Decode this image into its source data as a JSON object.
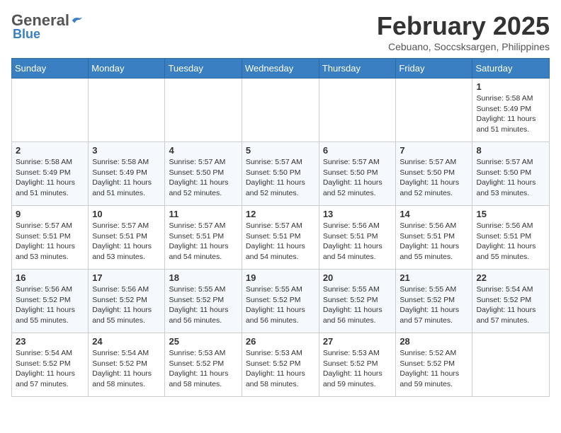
{
  "header": {
    "logo_general": "General",
    "logo_blue": "Blue",
    "month_title": "February 2025",
    "location": "Cebuano, Soccsksargen, Philippines"
  },
  "days_of_week": [
    "Sunday",
    "Monday",
    "Tuesday",
    "Wednesday",
    "Thursday",
    "Friday",
    "Saturday"
  ],
  "weeks": [
    [
      {
        "day": "",
        "info": ""
      },
      {
        "day": "",
        "info": ""
      },
      {
        "day": "",
        "info": ""
      },
      {
        "day": "",
        "info": ""
      },
      {
        "day": "",
        "info": ""
      },
      {
        "day": "",
        "info": ""
      },
      {
        "day": "1",
        "info": "Sunrise: 5:58 AM\nSunset: 5:49 PM\nDaylight: 11 hours\nand 51 minutes."
      }
    ],
    [
      {
        "day": "2",
        "info": "Sunrise: 5:58 AM\nSunset: 5:49 PM\nDaylight: 11 hours\nand 51 minutes."
      },
      {
        "day": "3",
        "info": "Sunrise: 5:58 AM\nSunset: 5:49 PM\nDaylight: 11 hours\nand 51 minutes."
      },
      {
        "day": "4",
        "info": "Sunrise: 5:57 AM\nSunset: 5:50 PM\nDaylight: 11 hours\nand 52 minutes."
      },
      {
        "day": "5",
        "info": "Sunrise: 5:57 AM\nSunset: 5:50 PM\nDaylight: 11 hours\nand 52 minutes."
      },
      {
        "day": "6",
        "info": "Sunrise: 5:57 AM\nSunset: 5:50 PM\nDaylight: 11 hours\nand 52 minutes."
      },
      {
        "day": "7",
        "info": "Sunrise: 5:57 AM\nSunset: 5:50 PM\nDaylight: 11 hours\nand 52 minutes."
      },
      {
        "day": "8",
        "info": "Sunrise: 5:57 AM\nSunset: 5:50 PM\nDaylight: 11 hours\nand 53 minutes."
      }
    ],
    [
      {
        "day": "9",
        "info": "Sunrise: 5:57 AM\nSunset: 5:51 PM\nDaylight: 11 hours\nand 53 minutes."
      },
      {
        "day": "10",
        "info": "Sunrise: 5:57 AM\nSunset: 5:51 PM\nDaylight: 11 hours\nand 53 minutes."
      },
      {
        "day": "11",
        "info": "Sunrise: 5:57 AM\nSunset: 5:51 PM\nDaylight: 11 hours\nand 54 minutes."
      },
      {
        "day": "12",
        "info": "Sunrise: 5:57 AM\nSunset: 5:51 PM\nDaylight: 11 hours\nand 54 minutes."
      },
      {
        "day": "13",
        "info": "Sunrise: 5:56 AM\nSunset: 5:51 PM\nDaylight: 11 hours\nand 54 minutes."
      },
      {
        "day": "14",
        "info": "Sunrise: 5:56 AM\nSunset: 5:51 PM\nDaylight: 11 hours\nand 55 minutes."
      },
      {
        "day": "15",
        "info": "Sunrise: 5:56 AM\nSunset: 5:51 PM\nDaylight: 11 hours\nand 55 minutes."
      }
    ],
    [
      {
        "day": "16",
        "info": "Sunrise: 5:56 AM\nSunset: 5:52 PM\nDaylight: 11 hours\nand 55 minutes."
      },
      {
        "day": "17",
        "info": "Sunrise: 5:56 AM\nSunset: 5:52 PM\nDaylight: 11 hours\nand 55 minutes."
      },
      {
        "day": "18",
        "info": "Sunrise: 5:55 AM\nSunset: 5:52 PM\nDaylight: 11 hours\nand 56 minutes."
      },
      {
        "day": "19",
        "info": "Sunrise: 5:55 AM\nSunset: 5:52 PM\nDaylight: 11 hours\nand 56 minutes."
      },
      {
        "day": "20",
        "info": "Sunrise: 5:55 AM\nSunset: 5:52 PM\nDaylight: 11 hours\nand 56 minutes."
      },
      {
        "day": "21",
        "info": "Sunrise: 5:55 AM\nSunset: 5:52 PM\nDaylight: 11 hours\nand 57 minutes."
      },
      {
        "day": "22",
        "info": "Sunrise: 5:54 AM\nSunset: 5:52 PM\nDaylight: 11 hours\nand 57 minutes."
      }
    ],
    [
      {
        "day": "23",
        "info": "Sunrise: 5:54 AM\nSunset: 5:52 PM\nDaylight: 11 hours\nand 57 minutes."
      },
      {
        "day": "24",
        "info": "Sunrise: 5:54 AM\nSunset: 5:52 PM\nDaylight: 11 hours\nand 58 minutes."
      },
      {
        "day": "25",
        "info": "Sunrise: 5:53 AM\nSunset: 5:52 PM\nDaylight: 11 hours\nand 58 minutes."
      },
      {
        "day": "26",
        "info": "Sunrise: 5:53 AM\nSunset: 5:52 PM\nDaylight: 11 hours\nand 58 minutes."
      },
      {
        "day": "27",
        "info": "Sunrise: 5:53 AM\nSunset: 5:52 PM\nDaylight: 11 hours\nand 59 minutes."
      },
      {
        "day": "28",
        "info": "Sunrise: 5:52 AM\nSunset: 5:52 PM\nDaylight: 11 hours\nand 59 minutes."
      },
      {
        "day": "",
        "info": ""
      }
    ]
  ]
}
